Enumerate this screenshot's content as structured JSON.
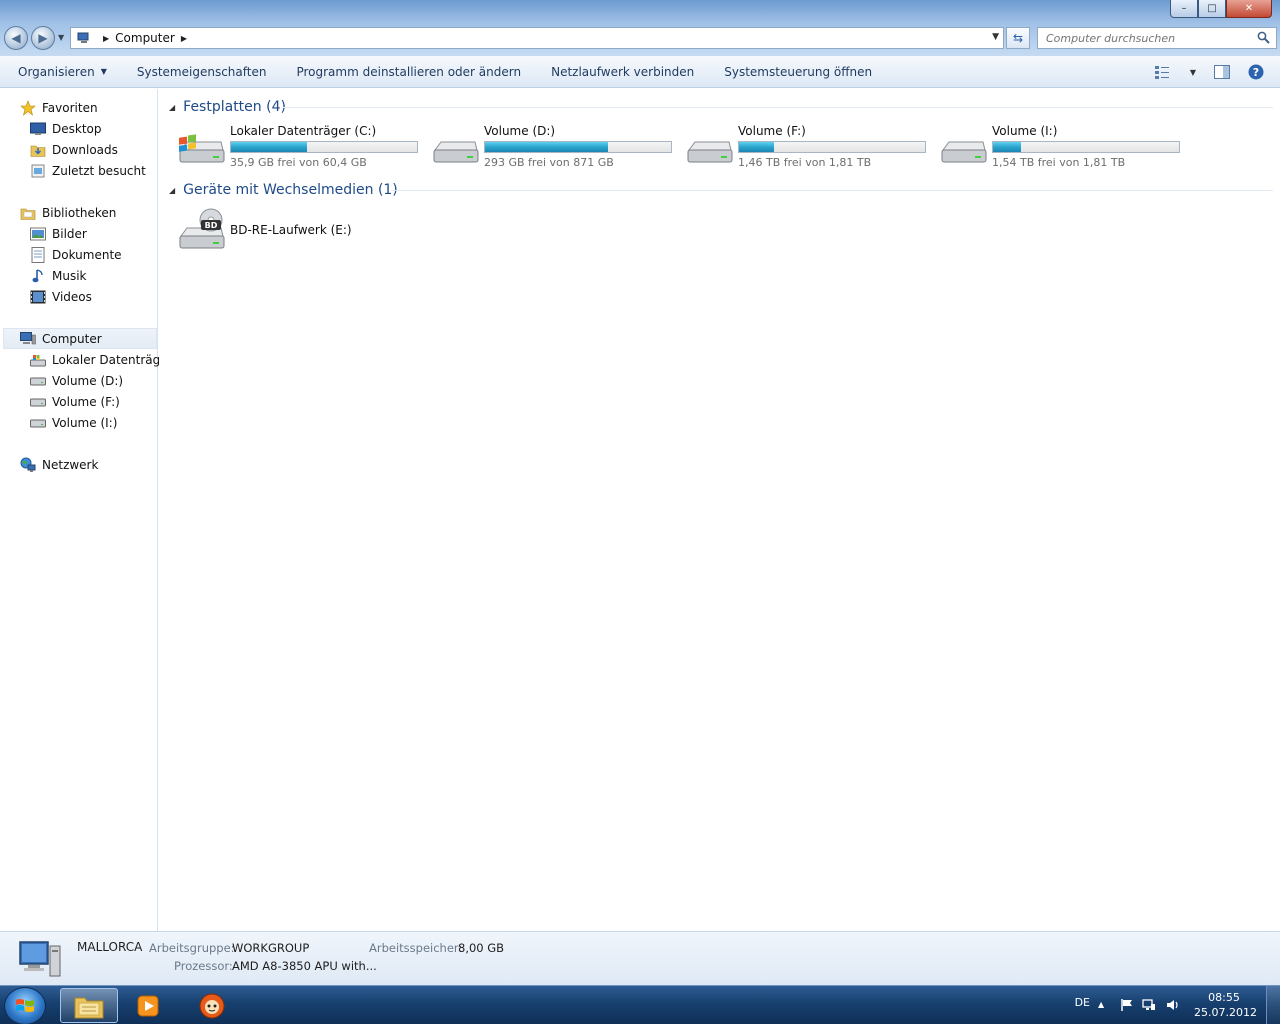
{
  "address": {
    "crumb": "Computer",
    "search_placeholder": "Computer durchsuchen"
  },
  "window_controls": {
    "minimize": "–",
    "maximize": "□",
    "close": "✕"
  },
  "toolbar": {
    "organize": "Organisieren",
    "system_properties": "Systemeigenschaften",
    "uninstall": "Programm deinstallieren oder ändern",
    "map_drive": "Netzlaufwerk verbinden",
    "control_panel": "Systemsteuerung öffnen"
  },
  "sidebar": {
    "favorites": {
      "label": "Favoriten",
      "items": [
        {
          "label": "Desktop",
          "icon": "desktop-icon"
        },
        {
          "label": "Downloads",
          "icon": "downloads-icon"
        },
        {
          "label": "Zuletzt besucht",
          "icon": "recent-places-icon"
        }
      ]
    },
    "libraries": {
      "label": "Bibliotheken",
      "items": [
        {
          "label": "Bilder",
          "icon": "pictures-icon"
        },
        {
          "label": "Dokumente",
          "icon": "documents-icon"
        },
        {
          "label": "Musik",
          "icon": "music-icon"
        },
        {
          "label": "Videos",
          "icon": "videos-icon"
        }
      ]
    },
    "computer": {
      "label": "Computer",
      "items": [
        {
          "label": "Lokaler Datenträger",
          "icon": "system-drive-icon"
        },
        {
          "label": "Volume (D:)",
          "icon": "drive-icon"
        },
        {
          "label": "Volume (F:)",
          "icon": "drive-icon"
        },
        {
          "label": "Volume (I:)",
          "icon": "drive-icon"
        }
      ]
    },
    "network": {
      "label": "Netzwerk",
      "icon": "network-icon"
    }
  },
  "groups": {
    "hard_drives": {
      "title": "Festplatten (4)",
      "drives": [
        {
          "name": "Lokaler Datenträger (C:)",
          "free_text": "35,9 GB frei von 60,4 GB",
          "used_fraction": 0.41
        },
        {
          "name": "Volume (D:)",
          "free_text": "293 GB frei von 871 GB",
          "used_fraction": 0.66
        },
        {
          "name": "Volume (F:)",
          "free_text": "1,46 TB frei von 1,81 TB",
          "used_fraction": 0.19
        },
        {
          "name": "Volume (I:)",
          "free_text": "1,54 TB frei von 1,81 TB",
          "used_fraction": 0.15
        }
      ]
    },
    "removable": {
      "title": "Geräte mit Wechselmedien (1)",
      "devices": [
        {
          "name": "BD-RE-Laufwerk (E:)",
          "icon_label": "BD"
        }
      ]
    }
  },
  "details": {
    "computer_name": "MALLORCA",
    "workgroup_label": "Arbeitsgruppe:",
    "workgroup_value": "WORKGROUP",
    "memory_label": "Arbeitsspeicher:",
    "memory_value": "8,00 GB",
    "processor_label": "Prozessor:",
    "processor_value": "AMD A8-3850 APU with..."
  },
  "taskbar": {
    "language": "DE",
    "time": "08:55",
    "date": "25.07.2012"
  },
  "colors": {
    "accent": "#1e4a8a",
    "bar_fill": "#2aa5cf",
    "taskbar": "#17406f"
  }
}
